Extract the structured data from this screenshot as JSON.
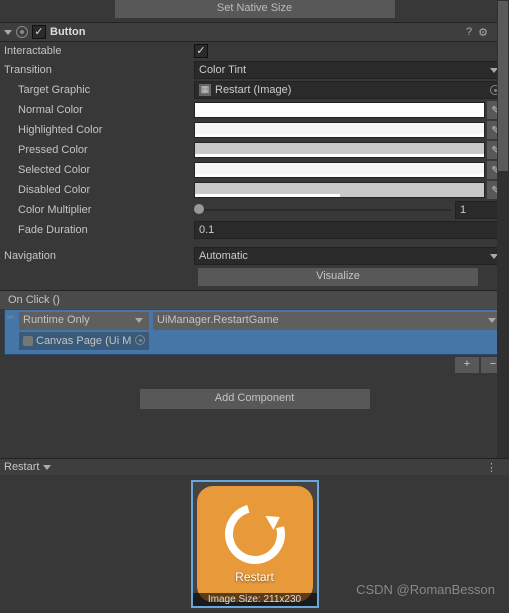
{
  "topButton": "Set Native Size",
  "component": {
    "title": "Button"
  },
  "props": {
    "interactable": "Interactable",
    "transition": {
      "label": "Transition",
      "value": "Color Tint"
    },
    "targetGraphic": {
      "label": "Target Graphic",
      "value": "Restart (Image)"
    },
    "normalColor": "Normal Color",
    "highlightedColor": "Highlighted Color",
    "pressedColor": "Pressed Color",
    "selectedColor": "Selected Color",
    "disabledColor": "Disabled Color",
    "colorMultiplier": {
      "label": "Color Multiplier",
      "value": "1"
    },
    "fadeDuration": {
      "label": "Fade Duration",
      "value": "0.1"
    },
    "navigation": {
      "label": "Navigation",
      "value": "Automatic"
    },
    "visualize": "Visualize"
  },
  "event": {
    "header": "On Click ()",
    "callState": "Runtime Only",
    "method": "UiManager.RestartGame",
    "target": "Canvas Page (Ui M"
  },
  "addComponent": "Add Component",
  "preview": {
    "tab": "Restart",
    "spriteLabel": "Restart",
    "dims": "Image Size: 211x230"
  },
  "watermark": "CSDN @RomanBesson"
}
